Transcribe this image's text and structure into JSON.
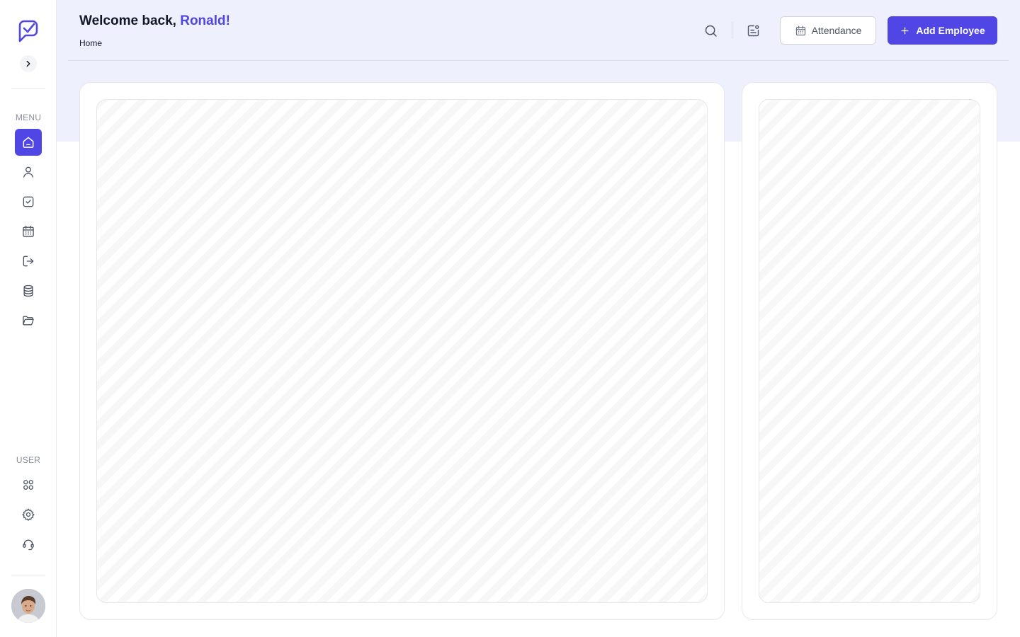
{
  "header": {
    "greeting": "Welcome back, ",
    "user_name": "Ronald!",
    "breadcrumb": "Home"
  },
  "actions": {
    "attendance_label": "Attendance",
    "add_employee_label": "Add Employee"
  },
  "sidebar": {
    "menu_label": "MENU",
    "user_label": "USER",
    "menu_items": [
      {
        "icon": "home-icon",
        "active": true
      },
      {
        "icon": "user-icon",
        "active": false
      },
      {
        "icon": "checkbox-icon",
        "active": false
      },
      {
        "icon": "calendar-icon",
        "active": false
      },
      {
        "icon": "logout-icon",
        "active": false
      },
      {
        "icon": "database-icon",
        "active": false
      },
      {
        "icon": "folder-icon",
        "active": false
      }
    ],
    "user_items": [
      {
        "icon": "apps-grid-icon"
      },
      {
        "icon": "gear-icon"
      },
      {
        "icon": "support-headset-icon"
      }
    ]
  },
  "colors": {
    "accent": "#4f46e5",
    "header_bg": "#eef1fd"
  }
}
